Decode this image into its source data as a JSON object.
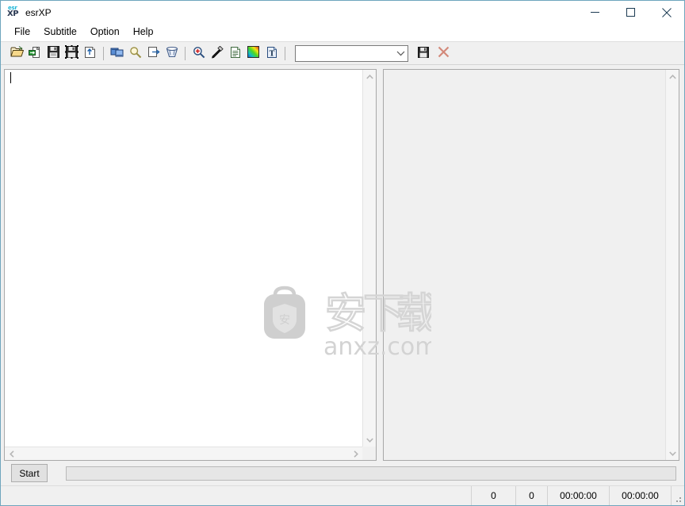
{
  "window": {
    "title": "esrXP",
    "logo_top": "esr",
    "logo_bottom": "XP",
    "accent_border": "#6ea5bd",
    "chrome_bg": "#f0f0f0"
  },
  "window_controls": [
    {
      "name": "minimize-button",
      "glyph": "minimize"
    },
    {
      "name": "maximize-button",
      "glyph": "maximize"
    },
    {
      "name": "close-button",
      "glyph": "close"
    }
  ],
  "menubar": {
    "items": [
      {
        "label": "File"
      },
      {
        "label": "Subtitle"
      },
      {
        "label": "Option"
      },
      {
        "label": "Help"
      }
    ]
  },
  "toolbar": {
    "buttons": [
      {
        "icon": "open-folder-icon",
        "title": "Open"
      },
      {
        "icon": "save-video-icon",
        "title": "Open video"
      },
      {
        "icon": "save-icon",
        "title": "Save"
      },
      {
        "icon": "save-as-icon",
        "title": "Save as"
      },
      {
        "icon": "export-icon",
        "title": "Export"
      },
      {
        "icon": "film-icon",
        "title": "Video"
      },
      {
        "icon": "magnifier-icon",
        "title": "Find"
      },
      {
        "icon": "open-window-icon",
        "title": "Open window"
      },
      {
        "icon": "clear-icon",
        "title": "Clear"
      },
      {
        "icon": "zoom-in-icon",
        "title": "Zoom in"
      },
      {
        "icon": "eyedropper-icon",
        "title": "Pick color"
      },
      {
        "icon": "document-lines-icon",
        "title": "Document"
      },
      {
        "icon": "color-gradient-icon",
        "title": "Colors"
      },
      {
        "icon": "text-document-icon",
        "title": "Text"
      }
    ],
    "profile_combo": {
      "value": "",
      "placeholder": "",
      "arrow": "chevron-down-icon"
    },
    "save_profile_icon": "save-icon",
    "delete_profile_icon": "delete-x-icon",
    "delete_color": "#d98c7d"
  },
  "panels": {
    "left": {
      "name": "subtitle-text-editor",
      "text": "",
      "caret_visible": true
    },
    "right": {
      "name": "preview-panel",
      "text": ""
    }
  },
  "watermark": {
    "site": "anxz.com",
    "characters": "安下载"
  },
  "bottom": {
    "start_button": "Start",
    "progress_value": 0
  },
  "statusbar": {
    "cells": [
      {
        "name": "status-message",
        "value": ""
      },
      {
        "name": "status-count-1",
        "value": "0"
      },
      {
        "name": "status-count-2",
        "value": "0"
      },
      {
        "name": "status-time-1",
        "value": "00:00:00"
      },
      {
        "name": "status-time-2",
        "value": "00:00:00"
      }
    ]
  }
}
